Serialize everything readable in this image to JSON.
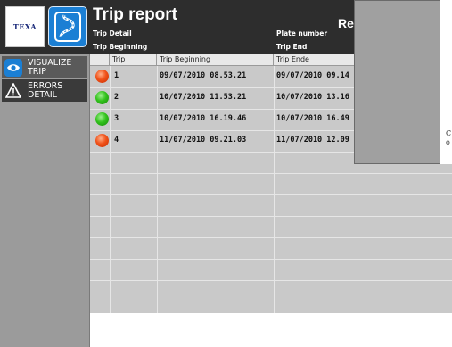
{
  "brand": {
    "logo_text": "TEXA",
    "app_icon": "road-route-icon"
  },
  "sidebar": {
    "items": [
      {
        "label": "VISUALIZE TRIP",
        "icon": "eye-icon"
      },
      {
        "label": "ERRORS DETAIL",
        "icon": "warning-icon"
      }
    ]
  },
  "header": {
    "title": "Trip report",
    "trip_detail_label": "Trip Detail",
    "trip_beginning_label": "Trip Beginning",
    "plate_number_label": "Plate number",
    "trip_end_label": "Trip End",
    "right_title_partial": "Re"
  },
  "table": {
    "columns": [
      "",
      "Trip",
      "Trip Beginning",
      "Trip Ende"
    ],
    "rows": [
      {
        "status": "red",
        "trip": "1",
        "begin": "09/07/2010 08.53.21",
        "end": "09/07/2010 09.14"
      },
      {
        "status": "green",
        "trip": "2",
        "begin": "10/07/2010 11.53.21",
        "end": "10/07/2010 13.16"
      },
      {
        "status": "green",
        "trip": "3",
        "begin": "10/07/2010 16.19.46",
        "end": "10/07/2010 16.49"
      },
      {
        "status": "red",
        "trip": "4",
        "begin": "11/07/2010 09.21.03",
        "end": "11/07/2010 12.09"
      }
    ]
  },
  "side_text": {
    "line1": "C",
    "line2": "o"
  },
  "colors": {
    "red_status": "#f0521a",
    "green_status": "#33c21c",
    "accent": "#1b7fd4"
  }
}
